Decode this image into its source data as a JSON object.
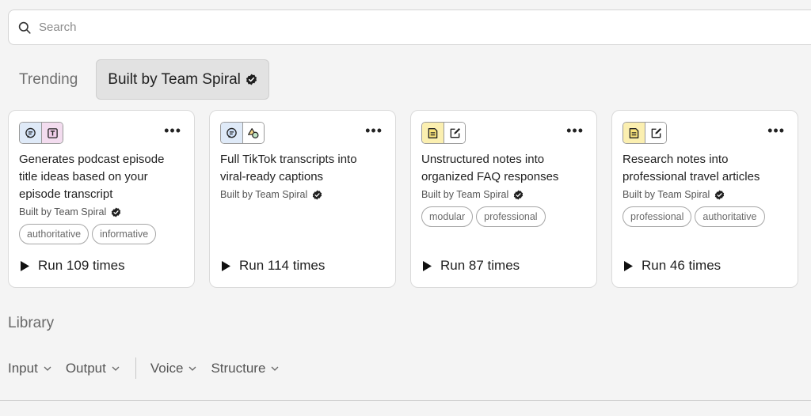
{
  "search": {
    "placeholder": "Search"
  },
  "tabs": [
    {
      "label": "Trending",
      "active": false
    },
    {
      "label": "Built by Team Spiral",
      "active": true
    }
  ],
  "cards": [
    {
      "title": "Generates podcast episode title ideas based on your episode transcript",
      "builder": "Built by Team Spiral",
      "tags": [
        "authoritative",
        "informative"
      ],
      "run_label": "Run 109 times",
      "icons": [
        "chat-bubble-icon",
        "title-text-icon"
      ]
    },
    {
      "title": "Full TikTok transcripts into viral-ready captions",
      "builder": "Built by Team Spiral",
      "tags": [],
      "run_label": "Run 114 times",
      "icons": [
        "chat-bubble-icon",
        "shapes-icon"
      ]
    },
    {
      "title": "Unstructured notes into organized FAQ responses",
      "builder": "Built by Team Spiral",
      "tags": [
        "modular",
        "professional"
      ],
      "run_label": "Run 87 times",
      "icons": [
        "note-icon",
        "edit-icon"
      ]
    },
    {
      "title": "Research notes into professional travel articles",
      "builder": "Built by Team Spiral",
      "tags": [
        "professional",
        "authoritative"
      ],
      "run_label": "Run 46 times",
      "icons": [
        "note-icon",
        "edit-icon"
      ]
    }
  ],
  "library": {
    "title": "Library",
    "filters": [
      "Input",
      "Output",
      "Voice",
      "Structure"
    ]
  },
  "colors": {
    "card_bg": "#ffffff",
    "page_bg": "#f4f4f4",
    "active_tab_bg": "#e2e2e2"
  }
}
